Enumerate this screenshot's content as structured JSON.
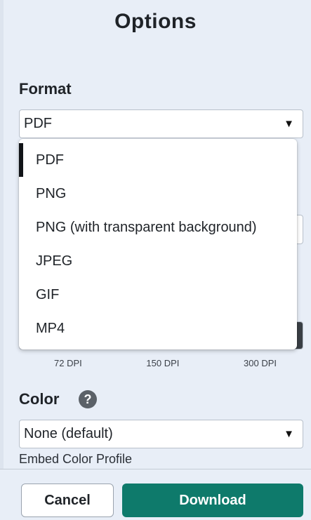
{
  "panel": {
    "title": "Options"
  },
  "format": {
    "label": "Format",
    "selected": "PDF",
    "options": [
      "PDF",
      "PNG",
      "PNG (with transparent background)",
      "JPEG",
      "GIF",
      "MP4"
    ]
  },
  "quality": {
    "labels": [
      "72 DPI",
      "150 DPI",
      "300 DPI"
    ],
    "selected_index": 2
  },
  "color": {
    "label": "Color",
    "help_glyph": "?",
    "selected": "None (default)",
    "embed_label": "Embed Color Profile"
  },
  "footer": {
    "cancel_label": "Cancel",
    "download_label": "Download"
  },
  "theme": {
    "accent": "#0e7a6b",
    "panel_bg": "#e8eef7"
  },
  "icons": {
    "select_caret": "▼"
  }
}
